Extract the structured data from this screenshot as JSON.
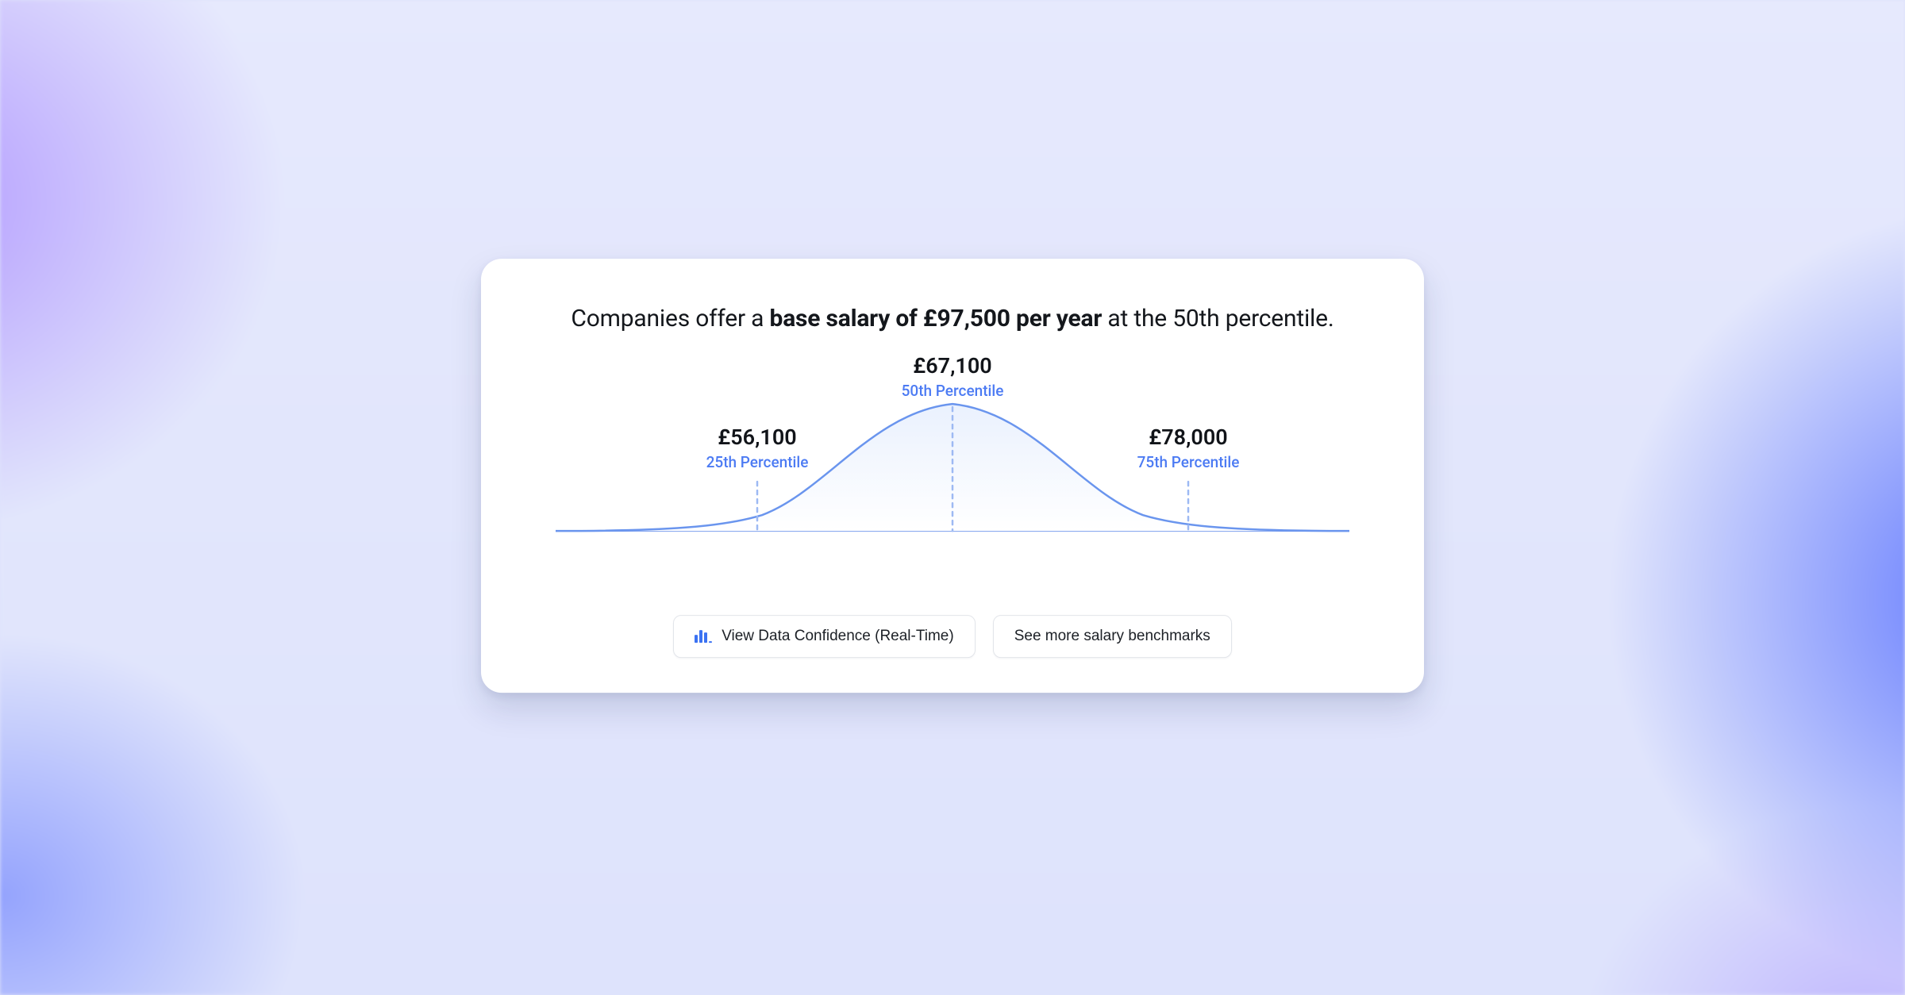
{
  "headline": {
    "prefix": "Companies offer a ",
    "bold": "base salary of £97,500 per year",
    "suffix": " at the 50th percentile."
  },
  "chart_data": {
    "type": "area",
    "title": "Salary distribution bell curve",
    "xlabel": "",
    "ylabel": "",
    "percentiles": [
      {
        "percentile": 25,
        "value_gbp": 56100,
        "value_label": "£56,100",
        "label": "25th Percentile"
      },
      {
        "percentile": 50,
        "value_gbp": 67100,
        "value_label": "£67,100",
        "label": "50th Percentile"
      },
      {
        "percentile": 75,
        "value_gbp": 78000,
        "value_label": "£78,000",
        "label": "75th Percentile"
      }
    ]
  },
  "colors": {
    "curve_stroke": "#6a95ee",
    "curve_fill_top": "#eaf1fe",
    "curve_fill_bottom": "#ffffff",
    "marker_text": "#4c7bf3",
    "dash": "#9db9f3"
  },
  "buttons": {
    "confidence": "View Data Confidence (Real-Time)",
    "more": "See more salary benchmarks"
  }
}
